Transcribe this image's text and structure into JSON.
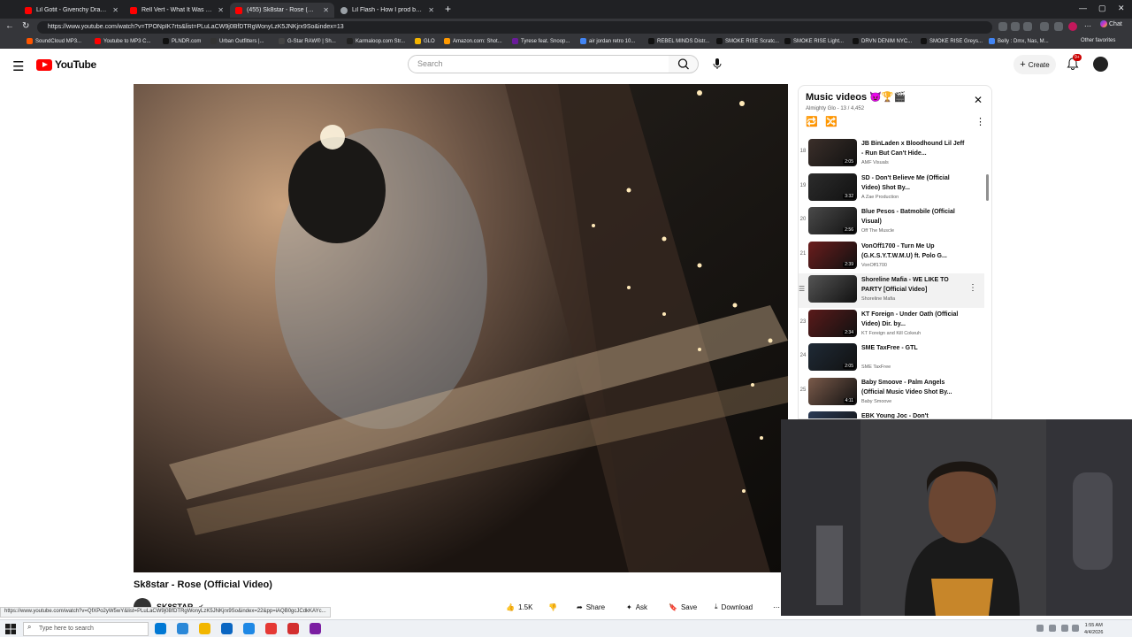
{
  "browser": {
    "tabs": [
      {
        "title": "Lil Gotit - Givenchy Draws (Official M",
        "favicon_color": "#ff0000",
        "active": false
      },
      {
        "title": "Rell Vert - What It Was (Official M",
        "favicon_color": "#ff0000",
        "active": false
      },
      {
        "title": "(455) Sk8star - Rose (Official",
        "favicon_color": "#ff0000",
        "active": true
      },
      {
        "title": "Lil Flash - How I prod by RPG Jake",
        "favicon_color": "#9aa0a6",
        "active": false
      }
    ],
    "url": "https://www.youtube.com/watch?v=TPONpIK7rts&list=PLuLaCW9j0BfDTRgWonyLzK5JNKjrx9So&index=13",
    "bookmarks": [
      {
        "label": "SoundCloud MP3...",
        "color": "#ff5500"
      },
      {
        "label": "Youtube to MP3 C...",
        "color": "#ff0000"
      },
      {
        "label": "PLNDR.com",
        "color": "#111111"
      },
      {
        "label": "Urban Outfitters |...",
        "color": "#333333"
      },
      {
        "label": "G-Star RAW® | Sh...",
        "color": "#444444"
      },
      {
        "label": "Karmaloop.com Str...",
        "color": "#222222"
      },
      {
        "label": "GLO",
        "color": "#f4b400"
      },
      {
        "label": "Amazon.com: Shot...",
        "color": "#ff9900"
      },
      {
        "label": "Tyrese feat. Snoop...",
        "color": "#6a1b9a"
      },
      {
        "label": "air jordan retro 10...",
        "color": "#4285f4"
      },
      {
        "label": "REBEL MINDS Distr...",
        "color": "#111111"
      },
      {
        "label": "SMOKE RISE Scratc...",
        "color": "#111111"
      },
      {
        "label": "SMOKE RISE Light...",
        "color": "#111111"
      },
      {
        "label": "DRVN DENIM NYC...",
        "color": "#111111"
      },
      {
        "label": "SMOKE RISE Greys...",
        "color": "#111111"
      },
      {
        "label": "Belly : Dmx, Nas, M...",
        "color": "#4285f4"
      }
    ],
    "other_favorites": "Other favorites",
    "chat_label": "Chat"
  },
  "youtube": {
    "logo_text": "YouTube",
    "search_placeholder": "Search",
    "create_label": "Create",
    "notification_count": "9+",
    "video_title": "Sk8star - Rose (Official Video)",
    "channel_name": "SK8STAR",
    "like_count": "1.5K",
    "share_label": "Share",
    "ask_label": "Ask",
    "save_label": "Save",
    "download_label": "Download"
  },
  "playlist": {
    "title": "Music videos 😈🏆🎬",
    "subtitle": "Almighty Glo - 13 / 4,452",
    "items": [
      {
        "index": "18",
        "title": "JB BinLaden x Bloodhound Lil Jeff - Run But Can't Hide...",
        "channel": "AMF Visuals",
        "duration": "2:05",
        "color": "#3b2f2a"
      },
      {
        "index": "19",
        "title": "SD - Don't Believe Me (Official Video) Shot By...",
        "channel": "A Zae Production",
        "duration": "3:32",
        "color": "#2c2c2c"
      },
      {
        "index": "20",
        "title": "Blue Pesos - Batmobile (Official Visual)",
        "channel": "Off The Muscle",
        "duration": "2:56",
        "color": "#4a4a4a"
      },
      {
        "index": "21",
        "title": "VonOff1700 - Turn Me Up (G.K.S.Y.T.W.M.U) ft. Polo G...",
        "channel": "VonOff1700",
        "duration": "2:39",
        "color": "#6b1d1d"
      },
      {
        "index": "",
        "title": "Shoreline Mafia - WE LIKE TO PARTY [Official Video]",
        "channel": "Shoreline Mafia",
        "duration": "",
        "color": "#555555",
        "hover": true
      },
      {
        "index": "23",
        "title": "KT Foreign - Under Oath (Official Video) Dir. by...",
        "channel": "KT Foreign and Kill Cokeuh",
        "duration": "2:34",
        "color": "#5a1a1a"
      },
      {
        "index": "24",
        "title": "SME TaxFree - GTL",
        "channel": "SME TaxFree",
        "duration": "2:05",
        "color": "#1f2a36"
      },
      {
        "index": "25",
        "title": "Baby Smoove - Palm Angels (Official Music Video Shot By...",
        "channel": "Baby Smoove",
        "duration": "4:11",
        "color": "#7a5a4a"
      },
      {
        "index": "",
        "title": "EBK Young Joc - Don't",
        "channel": "",
        "duration": "",
        "color": "#2a3a55"
      }
    ]
  },
  "status_bar_url": "https://www.youtube.com/watch?v=QfXPo2yW5wY&list=PLuLaCW9j0BfDTRgWonyLzK5JNKjrx9So&index=22&pp=iAQB0gcJCdkKAYc...",
  "taskbar": {
    "search_placeholder": "Type here to search",
    "time": "1:55 AM",
    "date": "4/4/2026",
    "apps": [
      {
        "color": "#0078d4"
      },
      {
        "color": "#2b88d8"
      },
      {
        "color": "#f2b600"
      },
      {
        "color": "#0a66c2"
      },
      {
        "color": "#1e88e5"
      },
      {
        "color": "#e53935"
      },
      {
        "color": "#d32f2f"
      },
      {
        "color": "#7b1fa2"
      }
    ]
  }
}
